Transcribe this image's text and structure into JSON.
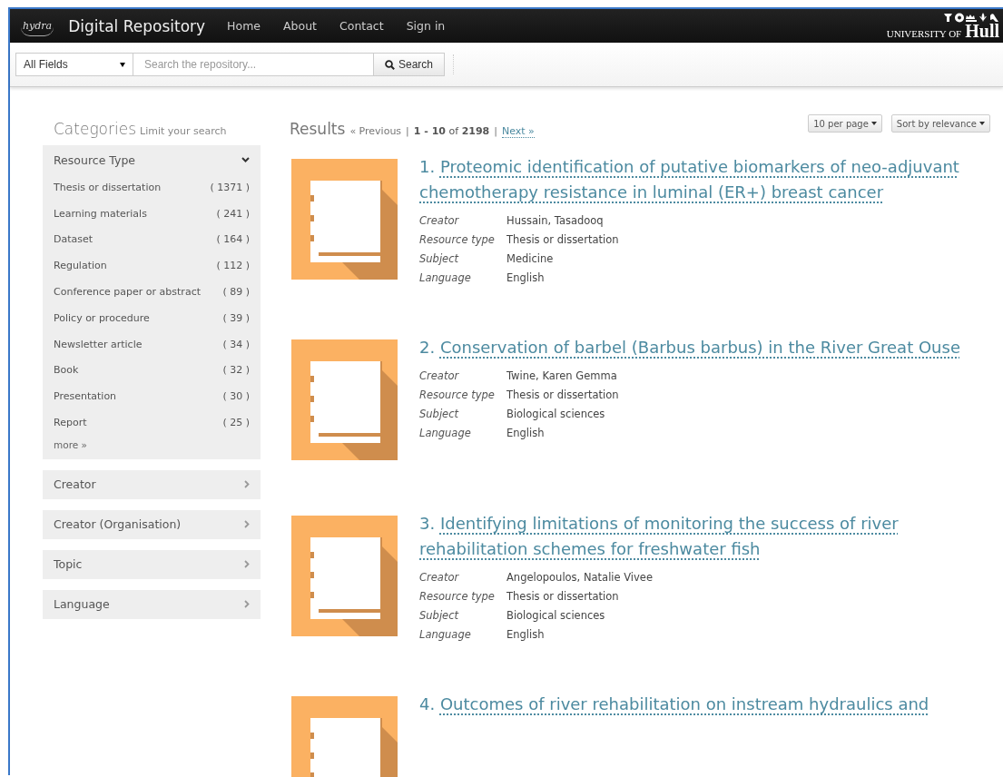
{
  "navbar": {
    "logo_text": "hydra",
    "brand": "Digital Repository",
    "links": [
      "Home",
      "About",
      "Contact",
      "Sign in"
    ],
    "university": {
      "prefix": "UNIVERSITY OF",
      "name": "Hull"
    }
  },
  "search": {
    "field": "All Fields",
    "placeholder": "Search the repository...",
    "button": "Search"
  },
  "categories": {
    "title": "Categories",
    "subtitle": "Limit your search",
    "facets": [
      {
        "label": "Resource Type",
        "expanded": true,
        "items": [
          {
            "label": "Thesis or dissertation",
            "count": "( 1371 )"
          },
          {
            "label": "Learning materials",
            "count": "( 241 )"
          },
          {
            "label": "Dataset",
            "count": "( 164 )"
          },
          {
            "label": "Regulation",
            "count": "( 112 )"
          },
          {
            "label": "Conference paper or abstract",
            "count": "( 89 )"
          },
          {
            "label": "Policy or procedure",
            "count": "( 39 )"
          },
          {
            "label": "Newsletter article",
            "count": "( 34 )"
          },
          {
            "label": "Book",
            "count": "( 32 )"
          },
          {
            "label": "Presentation",
            "count": "( 30 )"
          },
          {
            "label": "Report",
            "count": "( 25 )"
          }
        ],
        "more": "more »"
      },
      {
        "label": "Creator",
        "expanded": false
      },
      {
        "label": "Creator (Organisation)",
        "expanded": false
      },
      {
        "label": "Topic",
        "expanded": false
      },
      {
        "label": "Language",
        "expanded": false
      }
    ]
  },
  "results": {
    "title": "Results",
    "previous": "« Previous",
    "separators": [
      "|",
      "|"
    ],
    "range": "**1 - 10** of **2198**",
    "next": "Next »",
    "per_page": "10 per page",
    "sort": "Sort by relevance",
    "items": [
      {
        "number": "1.",
        "title": "Proteomic identification of putative biomarkers of neo-adjuvant chemotherapy resistance in luminal (ER+) breast cancer",
        "fields": [
          {
            "label": "Creator",
            "value": "Hussain, Tasadooq"
          },
          {
            "label": "Resource type",
            "value": "Thesis or dissertation"
          },
          {
            "label": "Subject",
            "value": "Medicine"
          },
          {
            "label": "Language",
            "value": "English"
          }
        ]
      },
      {
        "number": "2.",
        "title": "Conservation of barbel (Barbus barbus) in the River Great Ouse",
        "fields": [
          {
            "label": "Creator",
            "value": "Twine, Karen Gemma"
          },
          {
            "label": "Resource type",
            "value": "Thesis or dissertation"
          },
          {
            "label": "Subject",
            "value": "Biological sciences"
          },
          {
            "label": "Language",
            "value": "English"
          }
        ]
      },
      {
        "number": "3.",
        "title": "Identifying limitations of monitoring the success of river rehabilitation schemes for freshwater fish",
        "fields": [
          {
            "label": "Creator",
            "value": "Angelopoulos, Natalie Vivee"
          },
          {
            "label": "Resource type",
            "value": "Thesis or dissertation"
          },
          {
            "label": "Subject",
            "value": "Biological sciences"
          },
          {
            "label": "Language",
            "value": "English"
          }
        ]
      },
      {
        "number": "4.",
        "title": "Outcomes of river rehabilitation on instream hydraulics and"
      }
    ]
  }
}
